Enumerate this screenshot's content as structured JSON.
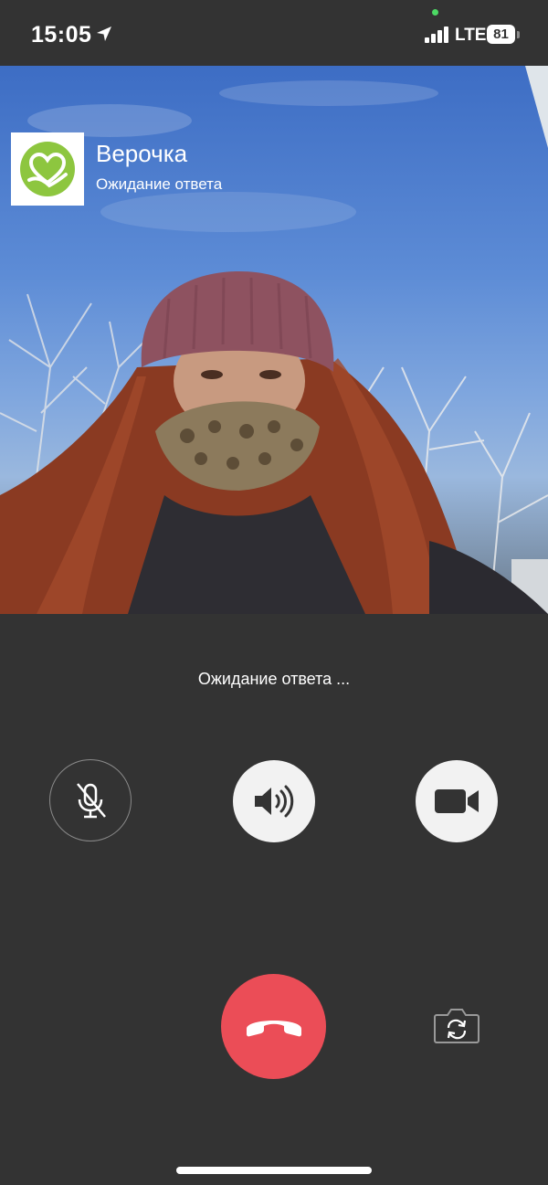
{
  "status_bar": {
    "time": "15:05",
    "network": "LTE",
    "battery": "81",
    "icons": [
      "location-arrow-icon",
      "signal-bars-icon",
      "battery-icon"
    ]
  },
  "caller": {
    "name": "Верочка",
    "status": "Ожидание ответа",
    "avatar_icon": "heart-hand-logo-icon",
    "avatar_color": "#8dc63f"
  },
  "call": {
    "waiting_text": "Ожидание ответа ..."
  },
  "controls": {
    "mic": {
      "icon": "mic-muted-icon",
      "active": false
    },
    "speaker": {
      "icon": "speaker-icon",
      "active": true
    },
    "video": {
      "icon": "video-camera-icon",
      "active": true
    },
    "hangup": {
      "icon": "phone-hangup-icon",
      "color": "#eb4d57"
    },
    "flip_camera": {
      "icon": "camera-flip-icon"
    }
  }
}
